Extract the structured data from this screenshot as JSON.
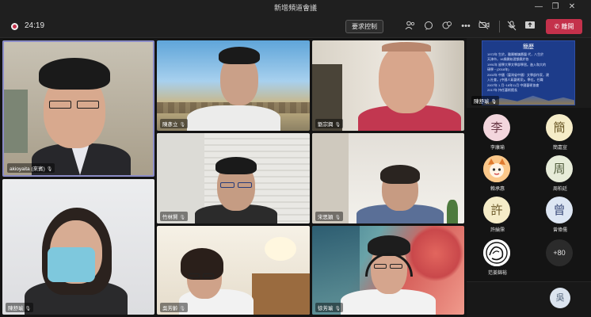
{
  "window": {
    "title": "新增頻道會議",
    "controls": {
      "minimize": "—",
      "maximize": "▢",
      "restore": "❐",
      "close": "✕"
    }
  },
  "toolbar": {
    "timer": "24:19",
    "request_control_label": "要求控制",
    "leave_label": "離開",
    "icons": [
      "participants-icon",
      "chat-icon",
      "reactions-icon",
      "more-icon",
      "camera-off-icon",
      "mic-off-icon",
      "share-icon",
      "phone-icon"
    ]
  },
  "grid": {
    "tiles": [
      {
        "name": "akioyaita (來賓)",
        "active": true
      },
      {
        "name": "陳彥立",
        "active": false
      },
      {
        "name": "劉宗興",
        "active": false
      },
      {
        "name": "竹林賢",
        "active": false
      },
      {
        "name": "宋思穎",
        "active": false
      },
      {
        "name": "陳舒瑜",
        "active": false
      },
      {
        "name": "吳芳齡",
        "active": false
      },
      {
        "name": "徐芳瑜",
        "active": false
      }
    ]
  },
  "share": {
    "presenter": "陳舒瑜",
    "slide_title": "簡歷",
    "slide_lines": [
      "1972年 生於。雖屬鄉鎮籌圍 代，八生於",
      "天津市，16歲開始習韻樂於各",
      "1991年 留學大學文學部學習。進入和大的",
      "碩學・(2018年)",
      "2002年 中國（臺灣省中國）文學部作家，建",
      "入社會。(中國人氣藝術家)。學位。任職",
      "2007年 1 月~18年11月 中國藝術協會",
      "2017年 持任藝術館長"
    ]
  },
  "participants": [
    {
      "initial": "李",
      "name": "李康瑜",
      "color": "#f3d6dd"
    },
    {
      "initial": "簡",
      "name": "簡嘉宣",
      "color": "#f5ecc8"
    },
    {
      "initial": "",
      "name": "賴承惠",
      "color": "#fbc88a"
    },
    {
      "initial": "周",
      "name": "周柏廷",
      "color": "#e7ecd9"
    },
    {
      "initial": "許",
      "name": "許綸霈",
      "color": "#f5ecc8"
    },
    {
      "initial": "曾",
      "name": "曾偉儒",
      "color": "#dde6f3"
    },
    {
      "initial": "",
      "name": "范姜錦裕",
      "color": "#ffffff"
    }
  ],
  "overflow_count": "+80",
  "bottom_avatar": {
    "initial": "吳"
  }
}
